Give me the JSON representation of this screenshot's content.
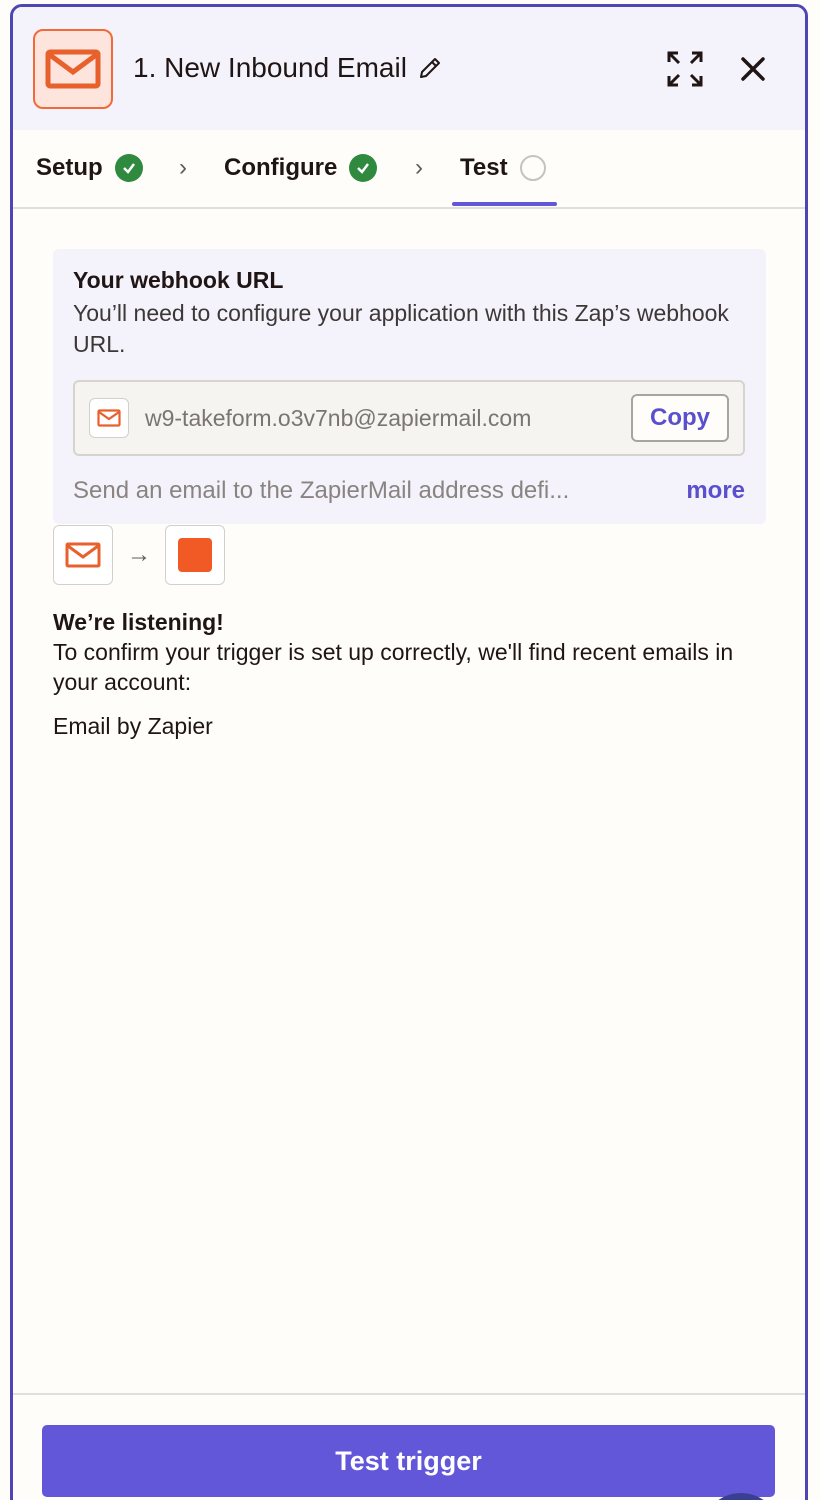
{
  "header": {
    "step_title": "1. New Inbound Email",
    "app_icon": "email-envelope-icon",
    "edit_icon": "pencil-icon",
    "expand_icon": "expand-icon",
    "close_icon": "close-icon"
  },
  "tabs": [
    {
      "label": "Setup",
      "status": "complete"
    },
    {
      "label": "Configure",
      "status": "complete"
    },
    {
      "label": "Test",
      "status": "pending",
      "active": true
    }
  ],
  "webhook": {
    "title": "Your webhook URL",
    "description": "You’ll need to configure your application with this Zap’s webhook URL.",
    "url": "w9-takeform.o3v7nb@zapiermail.com",
    "copy_label": "Copy",
    "help_text": "Send an email to the ZapierMail address defi...",
    "more_label": "more"
  },
  "listening": {
    "title": "We’re listening!",
    "description": "To confirm your trigger is set up correctly, we'll find recent emails in your account:",
    "app_name": "Email by Zapier"
  },
  "footer": {
    "test_button_label": "Test trigger"
  },
  "colors": {
    "accent": "#6357d9",
    "brand_orange": "#f15a24",
    "success": "#2f8a3f",
    "border": "#4f46b5"
  }
}
